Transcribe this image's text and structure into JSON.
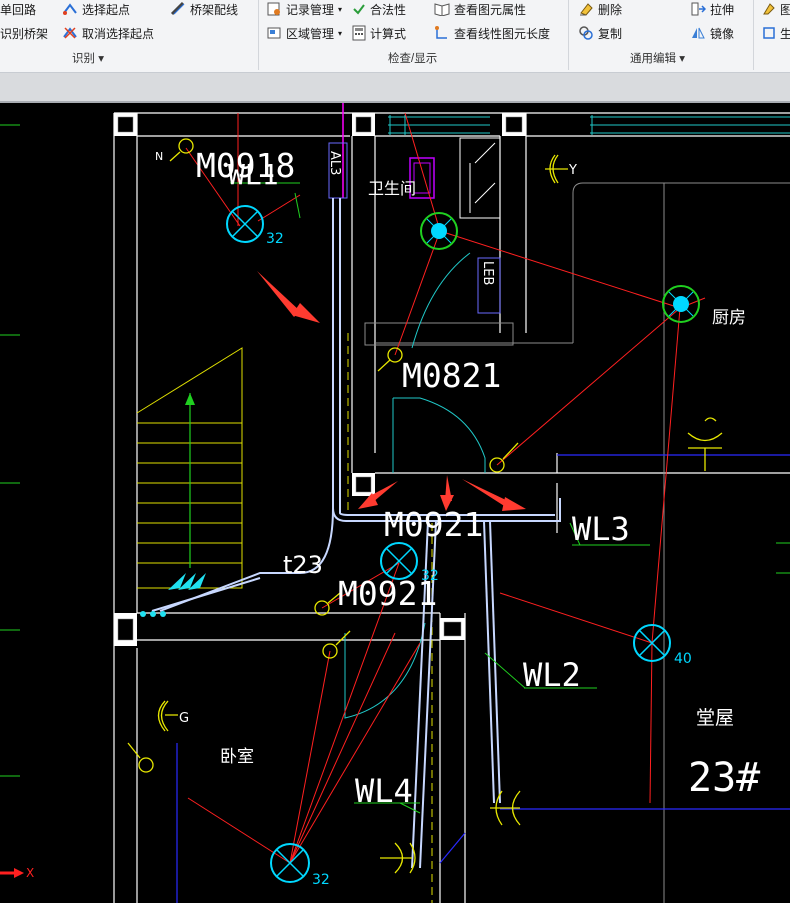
{
  "ribbon": {
    "groups": [
      {
        "label": "识别",
        "items": [
          {
            "label": "单回路",
            "icon": "single-loop-icon"
          },
          {
            "label": "识别桥架",
            "icon": "identify-tray-icon"
          },
          {
            "label": "选择起点",
            "icon": "select-start-icon"
          },
          {
            "label": "取消选择起点",
            "icon": "cancel-start-icon"
          },
          {
            "label": "桥架配线",
            "icon": "tray-wiring-icon"
          }
        ]
      },
      {
        "label": "检查/显示",
        "items": [
          {
            "label": "记录管理",
            "icon": "record-manage-icon"
          },
          {
            "label": "区域管理",
            "icon": "region-manage-icon"
          },
          {
            "label": "合法性",
            "icon": "check-icon"
          },
          {
            "label": "计算式",
            "icon": "calculator-icon"
          },
          {
            "label": "查看图元属性",
            "icon": "view-attributes-icon"
          },
          {
            "label": "查看线性图元长度",
            "icon": "view-length-icon"
          }
        ]
      },
      {
        "label": "通用编辑",
        "items": [
          {
            "label": "删除",
            "icon": "delete-icon"
          },
          {
            "label": "复制",
            "icon": "copy-icon"
          },
          {
            "label": "拉伸",
            "icon": "stretch-icon"
          },
          {
            "label": "镜像",
            "icon": "mirror-icon"
          }
        ]
      },
      {
        "label": "",
        "items": [
          {
            "label": "图",
            "icon": "layer-icon"
          },
          {
            "label": "生",
            "icon": "generate-icon"
          }
        ]
      }
    ]
  },
  "drawing": {
    "door_labels": [
      "M0918",
      "M0821",
      "M0921",
      "M0921"
    ],
    "room_labels": [
      "卫生间",
      "厨房",
      "卧室",
      "堂屋"
    ],
    "wire_labels": [
      "WL1",
      "WL2",
      "WL3",
      "WL4"
    ],
    "box_labels": [
      "AL3",
      "LEB"
    ],
    "lamp_numbers": [
      "32",
      "32",
      "32",
      "40"
    ],
    "switch_letters": [
      "N",
      "Y",
      "G"
    ],
    "conduit_label": "t23",
    "house_number": "23#",
    "axis_x": "X",
    "colors": {
      "wall": "#ffffff",
      "wire": "#ff2020",
      "lamp": "#00d8ff",
      "door": "#ffff33",
      "tray": "#c8d8ff",
      "arrow": "#ff3b30",
      "green": "#20d020",
      "blue": "#2020ff"
    }
  }
}
